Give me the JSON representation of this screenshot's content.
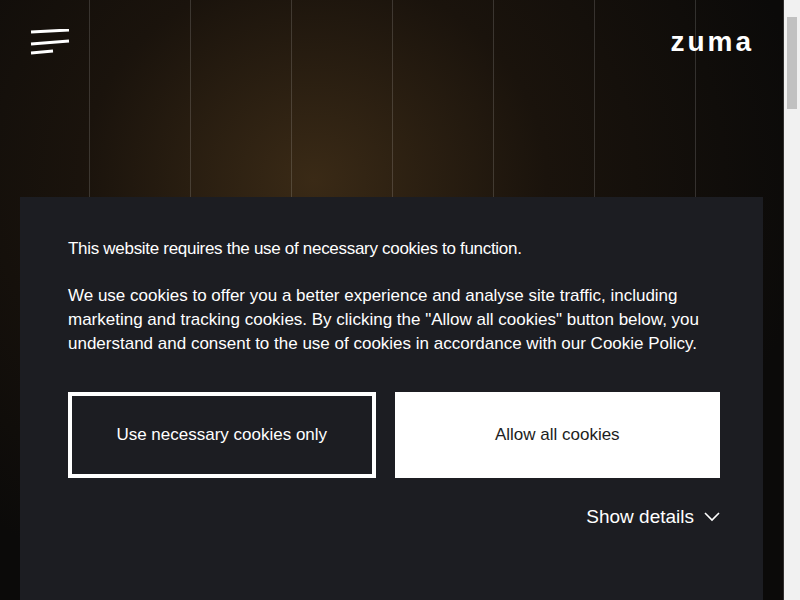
{
  "header": {
    "logo": "zuma"
  },
  "cookie_banner": {
    "title": "This website requires the use of necessary cookies to function.",
    "body": "We use cookies to offer you a better experience and analyse site traffic, including marketing and tracking cookies. By clicking the \"Allow all cookies\" button below, you understand and consent to the use of cookies in accordance with our Cookie Policy.",
    "buttons": [
      {
        "label": "Use necessary cookies only",
        "kind": "outline"
      },
      {
        "label": "Allow all cookies",
        "kind": "solid"
      }
    ],
    "details_toggle": {
      "label": "Show details",
      "expanded": false
    }
  }
}
